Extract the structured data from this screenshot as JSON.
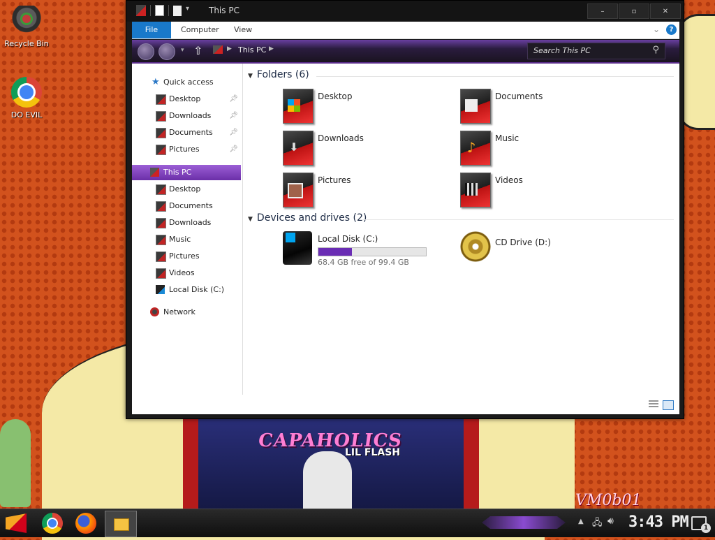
{
  "desktop": {
    "icons": [
      {
        "label": "Recycle Bin",
        "icon": "recycle-bin-icon"
      },
      {
        "label": "DO EVIL",
        "icon": "chrome-icon"
      }
    ],
    "wallpaper": {
      "album_title": "CAPAHOLICS",
      "album_artist": "LIL FLASH",
      "watermark": "VM0b01"
    }
  },
  "window": {
    "title": "This PC",
    "controls": {
      "minimize": "–",
      "maximize": "▫",
      "close": "✕"
    },
    "ribbon": {
      "tabs": [
        "File",
        "Computer",
        "View"
      ],
      "active_tab": "File"
    },
    "address": {
      "breadcrumb": [
        "This PC"
      ],
      "search_placeholder": "Search This PC"
    },
    "sidebar": {
      "quick_access": {
        "label": "Quick access",
        "items": [
          {
            "label": "Desktop",
            "pinned": true
          },
          {
            "label": "Downloads",
            "pinned": true
          },
          {
            "label": "Documents",
            "pinned": true
          },
          {
            "label": "Pictures",
            "pinned": true
          }
        ]
      },
      "this_pc": {
        "label": "This PC",
        "selected": true,
        "items": [
          {
            "label": "Desktop"
          },
          {
            "label": "Documents"
          },
          {
            "label": "Downloads"
          },
          {
            "label": "Music"
          },
          {
            "label": "Pictures"
          },
          {
            "label": "Videos"
          },
          {
            "label": "Local Disk (C:)"
          }
        ]
      },
      "network": {
        "label": "Network"
      }
    },
    "main": {
      "folders": {
        "header": "Folders (6)",
        "items": [
          {
            "label": "Desktop",
            "icon": "desktop-folder-icon"
          },
          {
            "label": "Documents",
            "icon": "documents-folder-icon"
          },
          {
            "label": "Downloads",
            "icon": "downloads-folder-icon"
          },
          {
            "label": "Music",
            "icon": "music-folder-icon"
          },
          {
            "label": "Pictures",
            "icon": "pictures-folder-icon"
          },
          {
            "label": "Videos",
            "icon": "videos-folder-icon"
          }
        ]
      },
      "devices": {
        "header": "Devices and drives (2)",
        "items": [
          {
            "label": "Local Disk (C:)",
            "free_text": "68.4 GB free of 99.4 GB",
            "used_fraction": 0.31,
            "icon": "hard-disk-icon"
          },
          {
            "label": "CD Drive (D:)",
            "icon": "cd-drive-icon"
          }
        ]
      }
    }
  },
  "taskbar": {
    "clock": "3:43 PM",
    "notification_count": "1",
    "apps": [
      "start-icon",
      "chrome-icon",
      "firefox-icon",
      "file-explorer-icon"
    ]
  },
  "colors": {
    "accent": "#1979ca",
    "selection": "#6b2fa8",
    "drive_bar": "#6a2db4"
  }
}
